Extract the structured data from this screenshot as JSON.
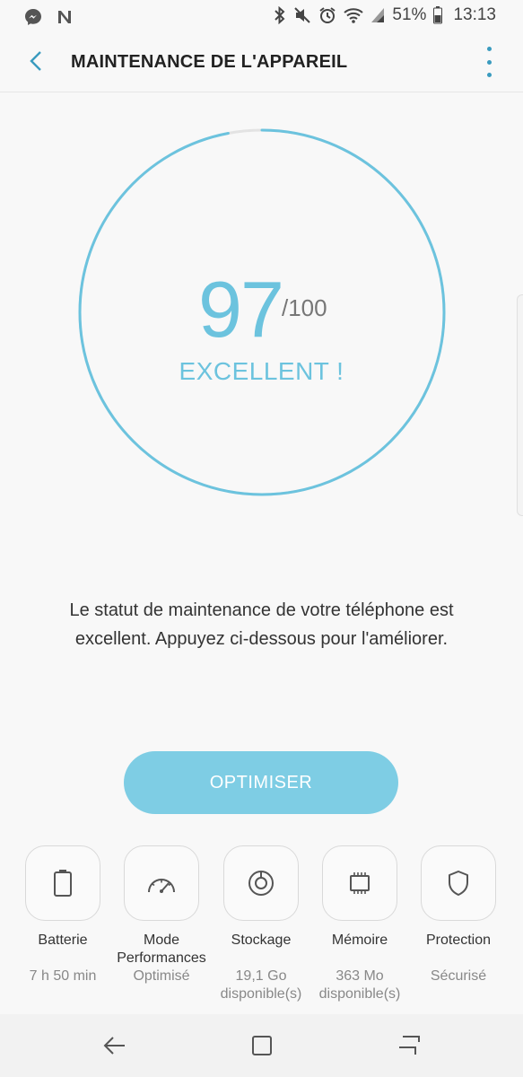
{
  "status_bar": {
    "battery_percent": "51%",
    "time": "13:13",
    "left_icons": [
      "messenger-icon",
      "nfc-icon"
    ],
    "right_icons": [
      "bluetooth-icon",
      "mute-icon",
      "alarm-icon",
      "wifi-icon",
      "signal-icon",
      "battery-icon"
    ]
  },
  "app_bar": {
    "title": "MAINTENANCE DE L'APPAREIL"
  },
  "score": {
    "value": "97",
    "max": "/100",
    "rating": "EXCELLENT !",
    "fraction": 0.97,
    "accent_color": "#6cc3de"
  },
  "description": "Le statut de maintenance de votre téléphone est excellent. Appuyez ci-dessous pour l'améliorer.",
  "optimize_button": {
    "label": "OPTIMISER",
    "color": "#7ecde4"
  },
  "tiles": [
    {
      "icon": "battery-icon",
      "label": "Batterie",
      "sub": "7 h 50 min"
    },
    {
      "icon": "speedometer-icon",
      "label": "Mode Performances",
      "sub": "Optimisé"
    },
    {
      "icon": "storage-icon",
      "label": "Stockage",
      "sub": "19,1 Go disponible(s)"
    },
    {
      "icon": "memory-chip-icon",
      "label": "Mémoire",
      "sub": "363 Mo disponible(s)"
    },
    {
      "icon": "shield-icon",
      "label": "Protection",
      "sub": "Sécurisé"
    }
  ],
  "nav_bar": [
    "back-icon",
    "home-icon",
    "recents-icon"
  ]
}
